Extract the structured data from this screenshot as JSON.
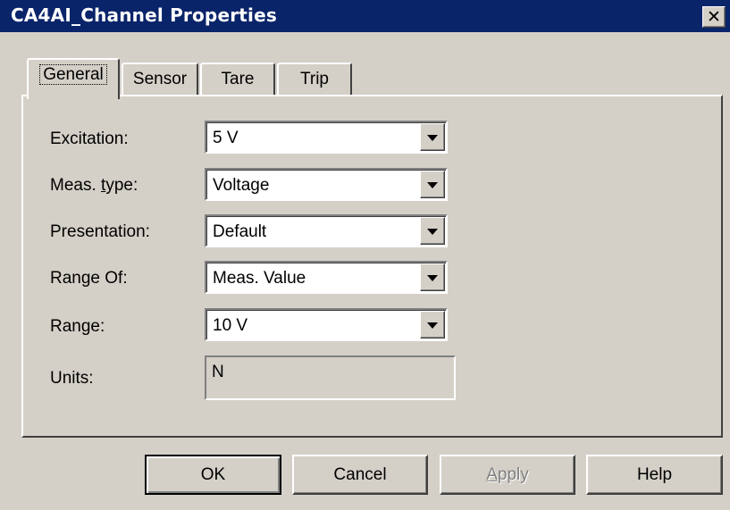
{
  "window": {
    "title": "CA4AI_Channel Properties",
    "close_glyph": "✕"
  },
  "tabs": [
    {
      "label": "General",
      "active": true
    },
    {
      "label": "Sensor",
      "active": false
    },
    {
      "label": "Tare",
      "active": false
    },
    {
      "label": "Trip",
      "active": false
    }
  ],
  "form": {
    "excitation": {
      "label": "Excitation:",
      "value": "5 V"
    },
    "meas_type": {
      "label_pre": "Meas. ",
      "label_ul": "t",
      "label_post": "ype:",
      "value": "Voltage"
    },
    "presentation": {
      "label": "Presentation:",
      "value": "Default"
    },
    "range_of": {
      "label": "Range Of:",
      "value": "Meas. Value"
    },
    "range": {
      "label": "Range:",
      "value": "10 V"
    },
    "units": {
      "label": "Units:",
      "value": "N"
    }
  },
  "buttons": {
    "ok": "OK",
    "cancel": "Cancel",
    "apply_ul": "A",
    "apply_rest": "pply",
    "help": "Help"
  },
  "colors": {
    "titlebar": "#0a246a",
    "face": "#d4d0c8"
  }
}
